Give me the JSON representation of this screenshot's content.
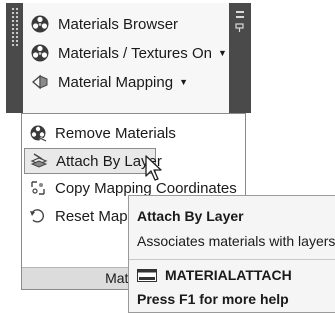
{
  "panel": {
    "items": [
      {
        "label": "Materials Browser",
        "icon": "materials-browser-icon",
        "has_dropdown": false
      },
      {
        "label": "Materials / Textures On",
        "icon": "materials-textures-icon",
        "has_dropdown": true
      },
      {
        "label": "Material Mapping",
        "icon": "material-mapping-icon",
        "has_dropdown": true
      }
    ],
    "caret": "▼"
  },
  "menu": {
    "items": [
      {
        "label": "Remove Materials",
        "icon": "remove-materials-icon"
      },
      {
        "label": "Attach By Layer",
        "icon": "attach-by-layer-icon",
        "highlighted": true
      },
      {
        "label": "Copy Mapping Coordinates",
        "icon": "copy-mapping-icon"
      },
      {
        "label": "Reset Mapping",
        "icon": "reset-mapping-icon"
      }
    ],
    "footer_label": "Materials"
  },
  "tooltip": {
    "title": "Attach By Layer",
    "description": "Associates materials with layers",
    "command": "MATERIALATTACH",
    "help": "Press F1 for more help"
  },
  "colors": {
    "panel_frame": "#5a5a5a",
    "panel_bg": "#f7f7f7",
    "highlight_bg": "#e9e9e9",
    "tooltip_bg": "#f5f5f5"
  }
}
